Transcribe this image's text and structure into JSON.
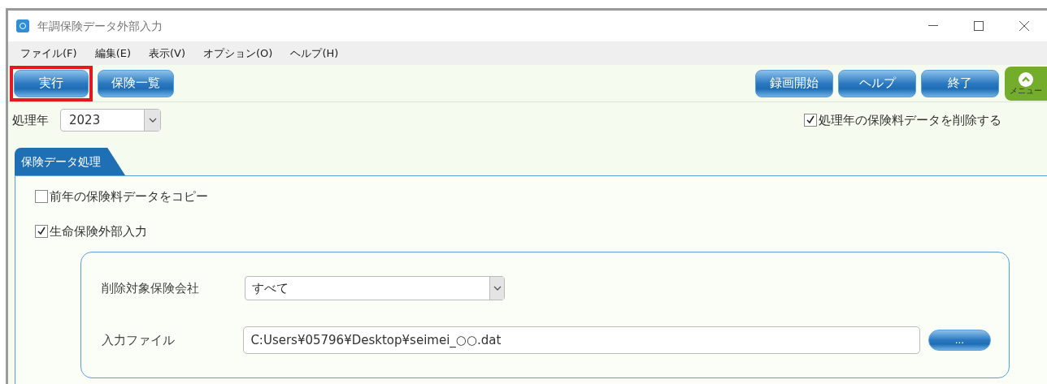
{
  "window": {
    "title": "年調保険データ外部入力"
  },
  "menu": [
    "ファイル(F)",
    "編集(E)",
    "表示(V)",
    "オプション(O)",
    "ヘルプ(H)"
  ],
  "toolbar_left": [
    {
      "label": "実行",
      "highlighted": true
    },
    {
      "label": "保険一覧",
      "highlighted": false
    }
  ],
  "toolbar_right": [
    {
      "label": "録画開始"
    },
    {
      "label": "ヘルプ"
    },
    {
      "label": "終了"
    }
  ],
  "menu_toggle": {
    "label": "メニュー"
  },
  "year": {
    "label": "処理年",
    "value": "2023"
  },
  "delete_option": {
    "label": "処理年の保険料データを削除する",
    "checked": true
  },
  "tabs": [
    {
      "label": "保険データ処理",
      "selected": true
    }
  ],
  "options": [
    {
      "label": "前年の保険料データをコピー",
      "checked": false
    },
    {
      "label": "生命保険外部入力",
      "checked": true
    }
  ],
  "company": {
    "label": "削除対象保険会社",
    "value": "すべて"
  },
  "input_file": {
    "label": "入力ファイル",
    "value": "C:Users¥05796¥Desktop¥seimei_○○.dat",
    "browse": "..."
  }
}
